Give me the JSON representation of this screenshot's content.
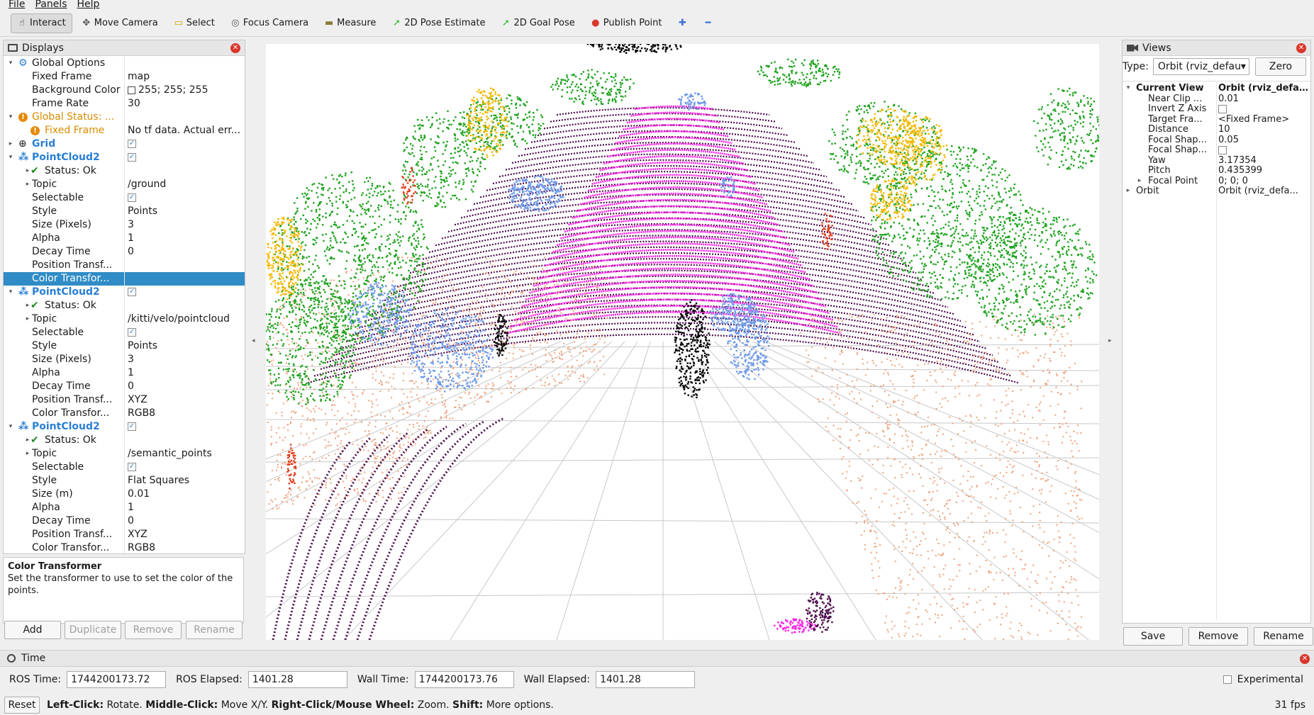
{
  "menu": [
    "File",
    "Panels",
    "Help"
  ],
  "toolbar": {
    "tools": [
      {
        "label": "Interact",
        "icon": "interact-icon",
        "glyph": "☝",
        "color": "#333333",
        "active": true
      },
      {
        "label": "Move Camera",
        "icon": "move-camera-icon",
        "glyph": "✥",
        "color": "#555555"
      },
      {
        "label": "Select",
        "icon": "select-icon",
        "glyph": "▭",
        "color": "#c9a800"
      },
      {
        "label": "Focus Camera",
        "icon": "focus-camera-icon",
        "glyph": "◎",
        "color": "#555555"
      },
      {
        "label": "Measure",
        "icon": "measure-icon",
        "glyph": "▬",
        "color": "#8a7a3a"
      },
      {
        "label": "2D Pose Estimate",
        "icon": "pose-estimate-icon",
        "glyph": "➚",
        "color": "#2db52d"
      },
      {
        "label": "2D Goal Pose",
        "icon": "goal-pose-icon",
        "glyph": "➚",
        "color": "#2db52d"
      },
      {
        "label": "Publish Point",
        "icon": "publish-point-icon",
        "glyph": "●",
        "color": "#d83a2a"
      },
      {
        "label": "",
        "icon": "add-tool-icon",
        "glyph": "✚",
        "color": "#3a6fd8"
      },
      {
        "label": "",
        "icon": "remove-tool-icon",
        "glyph": "━",
        "color": "#3a6fd8"
      }
    ]
  },
  "displays": {
    "title": "Displays",
    "rows": [
      {
        "indent": 0,
        "arrow": "▾",
        "icon": "⚙",
        "iconColor": "#2a7fd4",
        "name": "Global Options",
        "val": "",
        "style": ""
      },
      {
        "indent": 1,
        "arrow": "",
        "name": "Fixed Frame",
        "val": "map"
      },
      {
        "indent": 1,
        "arrow": "",
        "name": "Background Color",
        "val": "255; 255; 255",
        "color": true
      },
      {
        "indent": 1,
        "arrow": "",
        "name": "Frame Rate",
        "val": "30"
      },
      {
        "indent": 0,
        "arrow": "▾",
        "icon": "!",
        "iconColor": "#e58a00",
        "name": "Global Status: ...",
        "val": "",
        "style": "orange"
      },
      {
        "indent": 1,
        "arrow": "",
        "icon": "!",
        "iconColor": "#e58a00",
        "name": "Fixed Frame",
        "val": "No tf data.  Actual err...",
        "style": "orange"
      },
      {
        "indent": 0,
        "arrow": "▸",
        "icon": "⊕",
        "iconColor": "#444444",
        "name": "Grid",
        "val": "",
        "check": true,
        "style": "bold-blue"
      },
      {
        "indent": 0,
        "arrow": "▾",
        "icon": "⁂",
        "iconColor": "#2a7fd4",
        "name": "PointCloud2",
        "val": "",
        "check": true,
        "style": "bold-blue"
      },
      {
        "indent": 1,
        "arrow": "▸",
        "icon": "✔",
        "iconColor": "#1f8a1f",
        "name": "Status: Ok",
        "val": ""
      },
      {
        "indent": 1,
        "arrow": "▸",
        "name": "Topic",
        "val": "/ground"
      },
      {
        "indent": 1,
        "arrow": "",
        "name": "Selectable",
        "val": "",
        "check": true
      },
      {
        "indent": 1,
        "arrow": "",
        "name": "Style",
        "val": "Points"
      },
      {
        "indent": 1,
        "arrow": "",
        "name": "Size (Pixels)",
        "val": "3"
      },
      {
        "indent": 1,
        "arrow": "",
        "name": "Alpha",
        "val": "1"
      },
      {
        "indent": 1,
        "arrow": "",
        "name": "Decay Time",
        "val": "0"
      },
      {
        "indent": 1,
        "arrow": "",
        "name": "Position Transf...",
        "val": ""
      },
      {
        "indent": 1,
        "arrow": "",
        "name": "Color Transfor...",
        "val": "",
        "selected": true
      },
      {
        "indent": 0,
        "arrow": "▾",
        "icon": "⁂",
        "iconColor": "#2a7fd4",
        "name": "PointCloud2",
        "val": "",
        "check": true,
        "style": "bold-blue"
      },
      {
        "indent": 1,
        "arrow": "▸",
        "icon": "✔",
        "iconColor": "#1f8a1f",
        "name": "Status: Ok",
        "val": ""
      },
      {
        "indent": 1,
        "arrow": "▸",
        "name": "Topic",
        "val": "/kitti/velo/pointcloud"
      },
      {
        "indent": 1,
        "arrow": "",
        "name": "Selectable",
        "val": "",
        "check": true
      },
      {
        "indent": 1,
        "arrow": "",
        "name": "Style",
        "val": "Points"
      },
      {
        "indent": 1,
        "arrow": "",
        "name": "Size (Pixels)",
        "val": "3"
      },
      {
        "indent": 1,
        "arrow": "",
        "name": "Alpha",
        "val": "1"
      },
      {
        "indent": 1,
        "arrow": "",
        "name": "Decay Time",
        "val": "0"
      },
      {
        "indent": 1,
        "arrow": "",
        "name": "Position Transf...",
        "val": "XYZ"
      },
      {
        "indent": 1,
        "arrow": "",
        "name": "Color Transfor...",
        "val": "RGB8"
      },
      {
        "indent": 0,
        "arrow": "▾",
        "icon": "⁂",
        "iconColor": "#2a7fd4",
        "name": "PointCloud2",
        "val": "",
        "check": true,
        "style": "bold-blue"
      },
      {
        "indent": 1,
        "arrow": "▸",
        "icon": "✔",
        "iconColor": "#1f8a1f",
        "name": "Status: Ok",
        "val": ""
      },
      {
        "indent": 1,
        "arrow": "▸",
        "name": "Topic",
        "val": "/semantic_points"
      },
      {
        "indent": 1,
        "arrow": "",
        "name": "Selectable",
        "val": "",
        "check": true
      },
      {
        "indent": 1,
        "arrow": "",
        "name": "Style",
        "val": "Flat Squares"
      },
      {
        "indent": 1,
        "arrow": "",
        "name": "Size (m)",
        "val": "0.01"
      },
      {
        "indent": 1,
        "arrow": "",
        "name": "Alpha",
        "val": "1"
      },
      {
        "indent": 1,
        "arrow": "",
        "name": "Decay Time",
        "val": "0"
      },
      {
        "indent": 1,
        "arrow": "",
        "name": "Position Transf...",
        "val": "XYZ"
      },
      {
        "indent": 1,
        "arrow": "",
        "name": "Color Transfor...",
        "val": "RGB8"
      }
    ],
    "description_title": "Color Transformer",
    "description_text": "Set the transformer to use to set the color of the points.",
    "buttons": {
      "add": "Add",
      "duplicate": "Duplicate",
      "remove": "Remove",
      "rename": "Rename"
    }
  },
  "views": {
    "title": "Views",
    "type_label": "Type:",
    "type_value": "Orbit (rviz_defau",
    "zero_button": "Zero",
    "rows": [
      {
        "arrow": "▾",
        "indent": 0,
        "name": "Current View",
        "val": "Orbit (rviz_defa...",
        "bold": true
      },
      {
        "arrow": "",
        "indent": 1,
        "name": "Near Clip ...",
        "val": "0.01"
      },
      {
        "arrow": "",
        "indent": 1,
        "name": "Invert Z Axis",
        "val": "",
        "check": true
      },
      {
        "arrow": "",
        "indent": 1,
        "name": "Target Fra...",
        "val": "<Fixed Frame>"
      },
      {
        "arrow": "",
        "indent": 1,
        "name": "Distance",
        "val": "10"
      },
      {
        "arrow": "",
        "indent": 1,
        "name": "Focal Shap...",
        "val": "0.05"
      },
      {
        "arrow": "",
        "indent": 1,
        "name": "Focal Shap...",
        "val": "",
        "check": true
      },
      {
        "arrow": "",
        "indent": 1,
        "name": "Yaw",
        "val": "3.17354"
      },
      {
        "arrow": "",
        "indent": 1,
        "name": "Pitch",
        "val": "0.435399"
      },
      {
        "arrow": "▸",
        "indent": 1,
        "name": "Focal Point",
        "val": "0; 0; 0"
      },
      {
        "arrow": "▸",
        "indent": 0,
        "name": "Orbit",
        "val": "Orbit (rviz_defa..."
      }
    ],
    "buttons": {
      "save": "Save",
      "remove": "Remove",
      "rename": "Rename"
    }
  },
  "time": {
    "title": "Time",
    "ros_time_label": "ROS Time:",
    "ros_time": "1744200173.72",
    "ros_elapsed_label": "ROS Elapsed:",
    "ros_elapsed": "1401.28",
    "wall_time_label": "Wall Time:",
    "wall_time": "1744200173.76",
    "wall_elapsed_label": "Wall Elapsed:",
    "wall_elapsed": "1401.28",
    "experimental_label": "Experimental"
  },
  "status": {
    "reset": "Reset",
    "hint_parts": [
      {
        "b": "Left-Click:",
        "t": " Rotate. "
      },
      {
        "b": "Middle-Click:",
        "t": " Move X/Y. "
      },
      {
        "b": "Right-Click/Mouse Wheel:",
        "t": " Zoom. "
      },
      {
        "b": "Shift:",
        "t": " More options."
      }
    ],
    "fps": "31 fps"
  },
  "viewport": {
    "colors": {
      "road": "#ff22e6",
      "dark": "#4a0c4a",
      "vegetation": "#1fa31f",
      "building": "#f5b800",
      "car": "#6f9ae8",
      "sidewalk": "#f0a07a",
      "black": "#000000",
      "grid": "#c8c8c8",
      "red": "#e23b1a"
    }
  }
}
